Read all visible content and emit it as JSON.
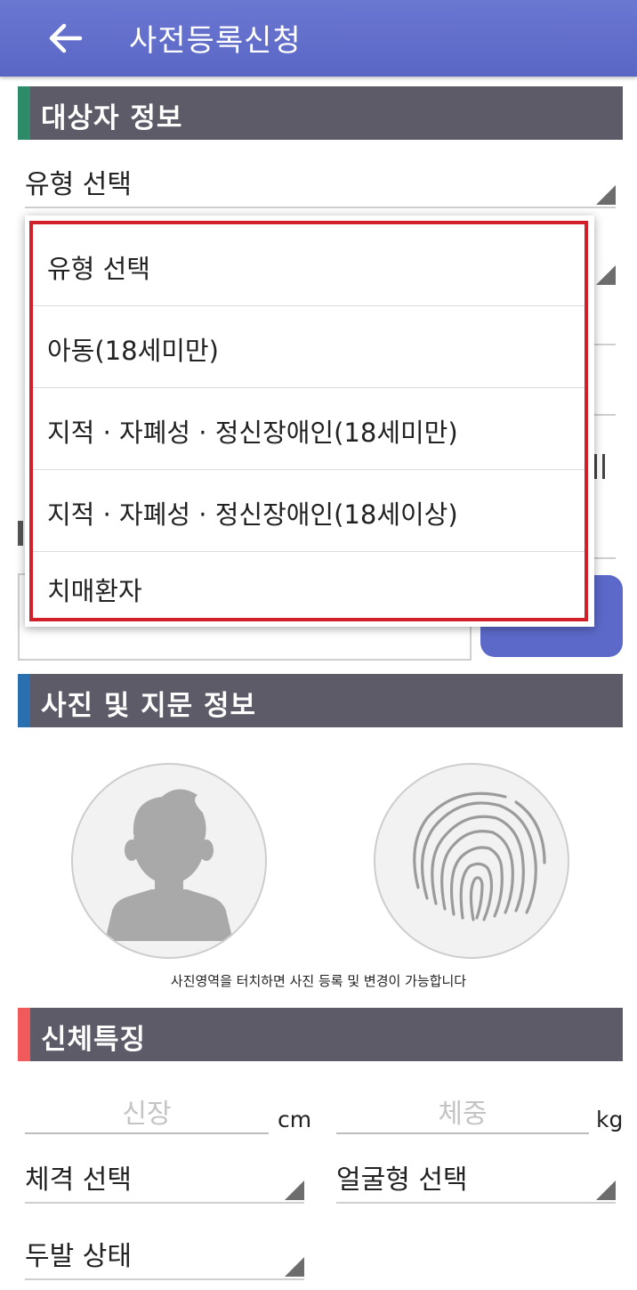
{
  "app_bar": {
    "title": "사전등록신청",
    "back_icon": "arrow-left-icon"
  },
  "colors": {
    "app_bar": "#5a66c4",
    "section_header": "#5c5b67",
    "accent_target": "#2e8b6a",
    "accent_photo": "#2a6fb0",
    "accent_body": "#f05a5a",
    "dropdown_highlight": "#d2202a",
    "primary_button": "#5c69c9"
  },
  "sections": {
    "target": {
      "title": "대상자 정보"
    },
    "photo": {
      "title": "사진 및 지문 정보"
    },
    "body": {
      "title": "신체특징"
    }
  },
  "target": {
    "type_select": "유형 선택"
  },
  "type_dropdown": {
    "options": [
      "유형 선택",
      "아동(18세미만)",
      "지적 · 자폐성 · 정신장애인(18세미만)",
      "지적 · 자폐성 · 정신장애인(18세이상)",
      "치매환자"
    ]
  },
  "photo": {
    "caption": "사진영역을 터치하면 사진 등록 및 변경이 가능합니다",
    "person_icon": "person-silhouette-icon",
    "fingerprint_icon": "fingerprint-icon"
  },
  "body": {
    "height_placeholder": "신장",
    "height_unit": "cm",
    "weight_placeholder": "체중",
    "weight_unit": "kg",
    "build_select": "체격 선택",
    "face_select": "얼굴형 선택",
    "hair_select": "두발 상태"
  }
}
